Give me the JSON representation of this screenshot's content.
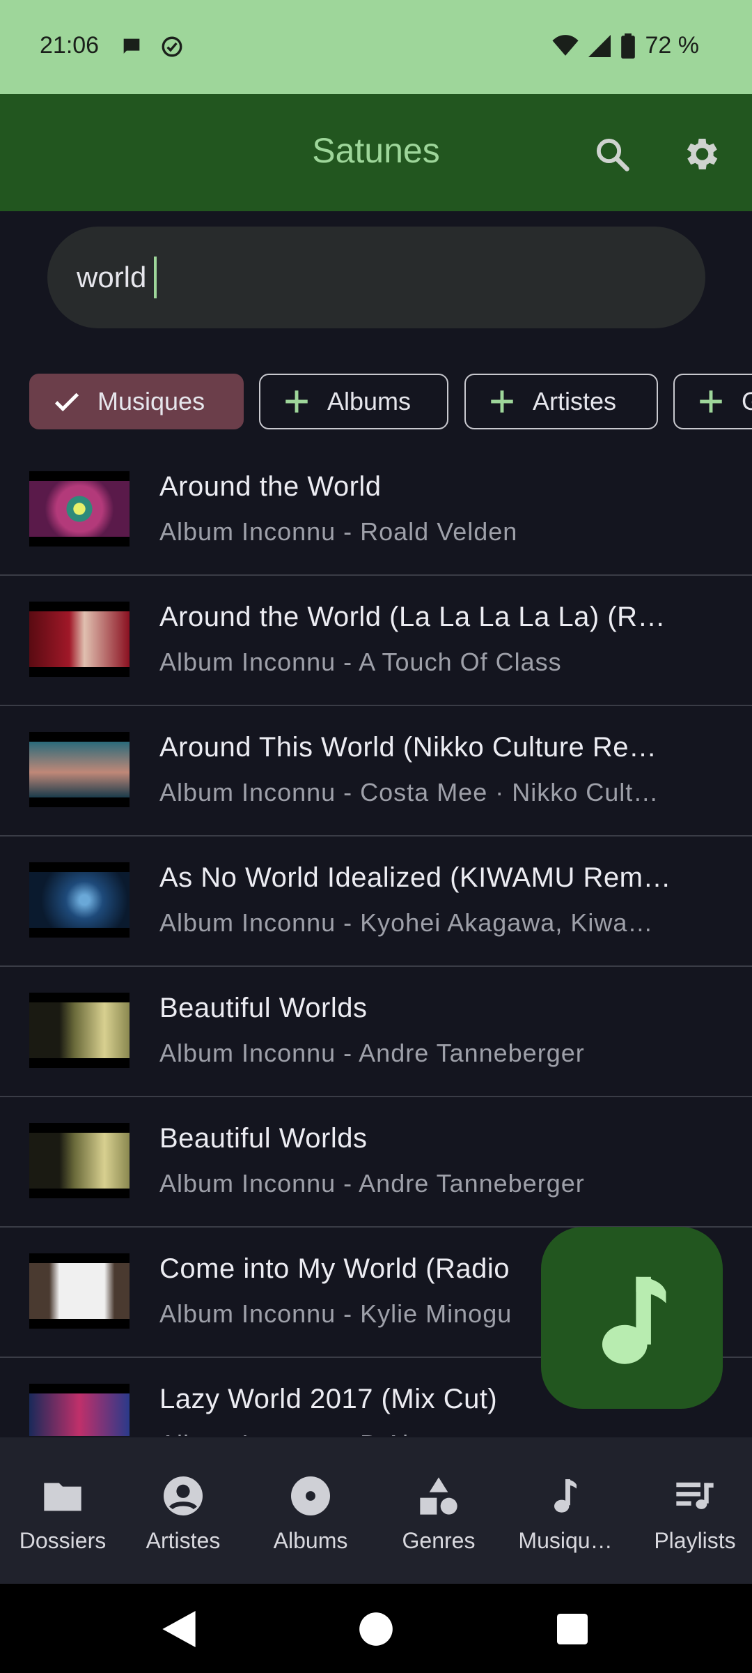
{
  "status_bar": {
    "time": "21:06",
    "battery_text": "72 %",
    "left_icons": [
      "chat-bubble-icon",
      "check-circle-icon"
    ],
    "right_icons": [
      "wifi-icon",
      "signal-icon",
      "battery-icon"
    ]
  },
  "app_bar": {
    "title": "Satunes",
    "actions": [
      "search-icon",
      "settings-icon"
    ]
  },
  "search": {
    "value": "world"
  },
  "filter_chips": [
    {
      "label": "Musiques",
      "selected": true,
      "icon": "check-icon"
    },
    {
      "label": "Albums",
      "selected": false,
      "icon": "plus-icon"
    },
    {
      "label": "Artistes",
      "selected": false,
      "icon": "plus-icon"
    },
    {
      "label": "G",
      "selected": false,
      "icon": "plus-icon"
    }
  ],
  "results": [
    {
      "title": "Around the World",
      "subtitle": "Album Inconnu - Roald Velden"
    },
    {
      "title": "Around the World (La La La La La) (R…",
      "subtitle": "Album Inconnu - A Touch Of Class"
    },
    {
      "title": "Around This World (Nikko Culture Re…",
      "subtitle": "Album Inconnu - Costa Mee · Nikko Cult…"
    },
    {
      "title": "As No World Idealized (KIWAMU Rem…",
      "subtitle": "Album Inconnu - Kyohei Akagawa, Kiwa…"
    },
    {
      "title": "Beautiful Worlds",
      "subtitle": "Album Inconnu - Andre Tanneberger"
    },
    {
      "title": "Beautiful Worlds",
      "subtitle": "Album Inconnu - Andre Tanneberger"
    },
    {
      "title": "Come into My World (Radio",
      "subtitle": "Album Inconnu - Kylie Minogu"
    },
    {
      "title": "Lazy World 2017 (Mix Cut)",
      "subtitle": "Album Inconnu - D Al"
    }
  ],
  "fab": {
    "icon": "music-note-icon"
  },
  "bottom_nav": [
    {
      "label": "Dossiers",
      "icon": "folder-icon"
    },
    {
      "label": "Artistes",
      "icon": "person-icon"
    },
    {
      "label": "Albums",
      "icon": "album-icon"
    },
    {
      "label": "Genres",
      "icon": "shapes-icon"
    },
    {
      "label": "Musiqu…",
      "icon": "music-note-icon"
    },
    {
      "label": "Playlists",
      "icon": "playlist-icon"
    }
  ],
  "colors": {
    "status_bar": "#9ed69a",
    "app_bar": "#22561f",
    "accent": "#9ed69a",
    "selected_chip": "#6b3e4a",
    "background": "#14151f"
  }
}
